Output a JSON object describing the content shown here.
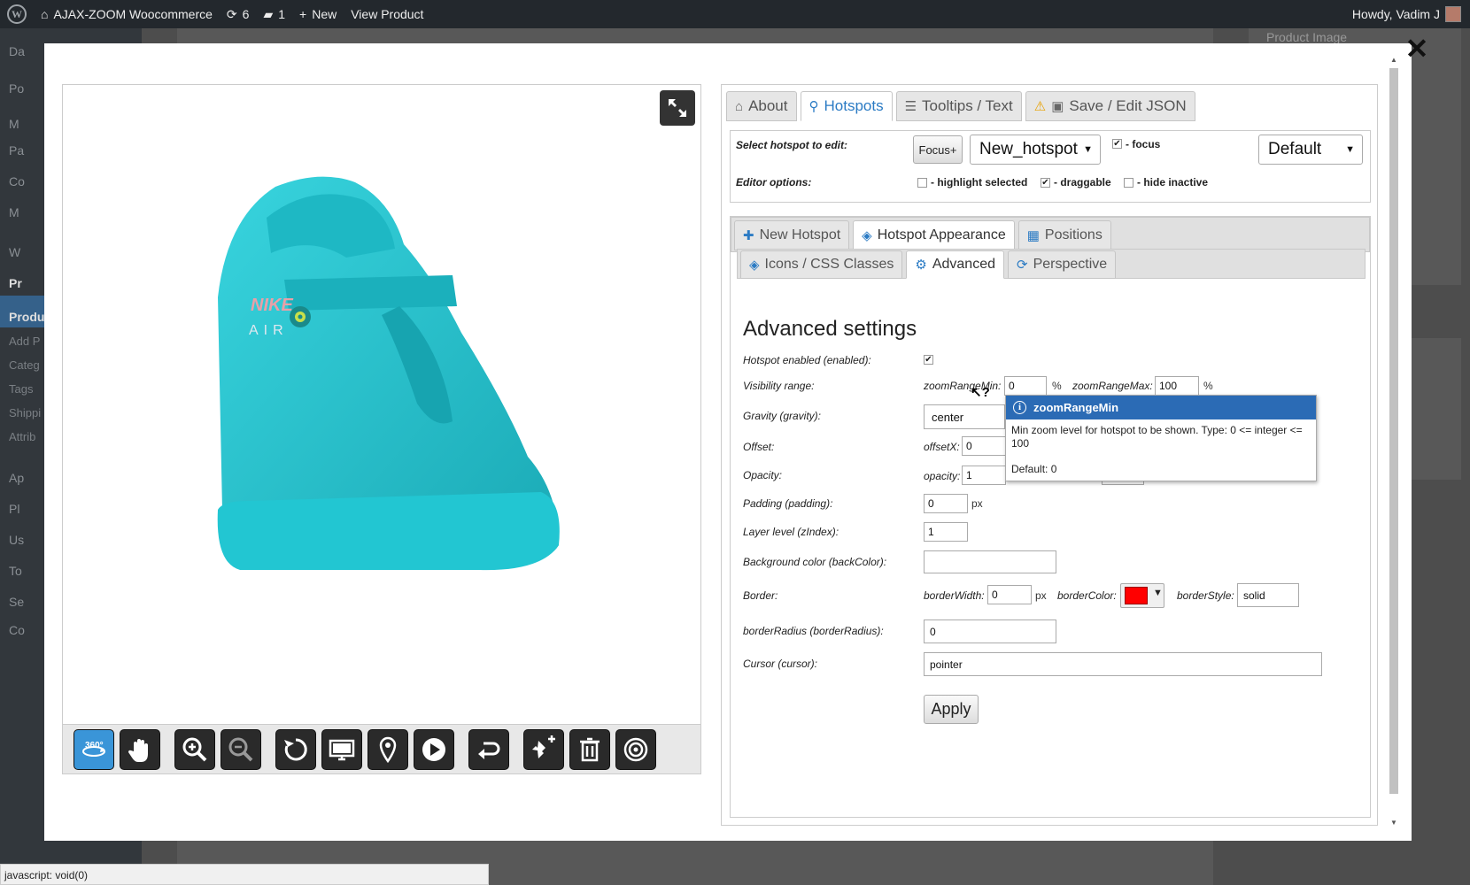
{
  "adminbar": {
    "site_name": "AJAX-ZOOM Woocommerce",
    "updates_count": "6",
    "comments_count": "1",
    "new_label": "New",
    "view_product": "View Product",
    "greeting": "Howdy, Vadim J"
  },
  "sidebar": {
    "items": [
      "Da",
      "Po",
      "M",
      "Pa",
      "Co",
      "M",
      "W",
      "Pr",
      "Produ",
      "Add P",
      "Categ",
      "Tags",
      "Shippi",
      "Attrib",
      "Ap",
      "Pl",
      "Us",
      "To",
      "Se",
      "Co"
    ]
  },
  "bgpage": {
    "product_image": "Product Image"
  },
  "tabs_main": [
    {
      "label": "About",
      "icon": "home-icon"
    },
    {
      "label": "Hotspots",
      "icon": "map-marker-icon"
    },
    {
      "label": "Tooltips / Text",
      "icon": "list-icon"
    },
    {
      "label": "Save / Edit JSON",
      "icon": "save-icon"
    }
  ],
  "select_hotspot": {
    "label": "Select hotspot to edit:",
    "focus_button": "Focus+",
    "hotspot_value": "New_hotspot",
    "focus_label": "- focus",
    "preset_value": "Default"
  },
  "editor_options": {
    "label": "Editor options:",
    "highlight": "- highlight selected",
    "draggable": "- draggable",
    "hide_inactive": "- hide inactive"
  },
  "tabs_hotspot": [
    {
      "label": "New Hotspot"
    },
    {
      "label": "Hotspot Appearance"
    },
    {
      "label": "Positions"
    }
  ],
  "tabs_appearance": [
    {
      "label": "Icons / CSS Classes"
    },
    {
      "label": "Advanced"
    },
    {
      "label": "Perspective"
    }
  ],
  "advanced": {
    "title": "Advanced settings",
    "enabled_label": "Hotspot enabled (enabled):",
    "visibility_label": "Visibility range:",
    "zoom_min_label": "zoomRangeMin:",
    "zoom_min_value": "0",
    "zoom_max_label": "zoomRangeMax:",
    "zoom_max_value": "100",
    "percent": "%",
    "gravity_label": "Gravity (gravity):",
    "gravity_value": "center",
    "offset_label": "Offset:",
    "offsetx_label": "offsetX:",
    "offsetx_value": "0",
    "opacity_label": "Opacity:",
    "opacity_field_label": "opacity:",
    "opacity_value": "1",
    "padding_label": "Padding (padding):",
    "padding_value": "0",
    "px": "px",
    "layer_label": "Layer level (zIndex):",
    "layer_value": "1",
    "backcolor_label": "Background color (backColor):",
    "backcolor_value": "",
    "border_label": "Border:",
    "border_width_label": "borderWidth:",
    "border_width_value": "0",
    "border_color_label": "borderColor:",
    "border_style_label": "borderStyle:",
    "border_style_value": "solid",
    "radius_label": "borderRadius (borderRadius):",
    "radius_value": "0",
    "cursor_label": "Cursor (cursor):",
    "cursor_value": "pointer",
    "apply_button": "Apply"
  },
  "tooltip": {
    "title": "zoomRangeMin",
    "body": "Min zoom level for hotspot to be shown. Type: 0 <= integer <= 100",
    "default": "Default: 0"
  },
  "product_logo": {
    "brand": "NIKE",
    "sub": "AIR"
  },
  "statusbar": {
    "text": "javascript: void(0)"
  },
  "colors": {
    "accent": "#2b7bc4",
    "shoe": "#2ac4cf",
    "border_color": "#ff0000"
  }
}
